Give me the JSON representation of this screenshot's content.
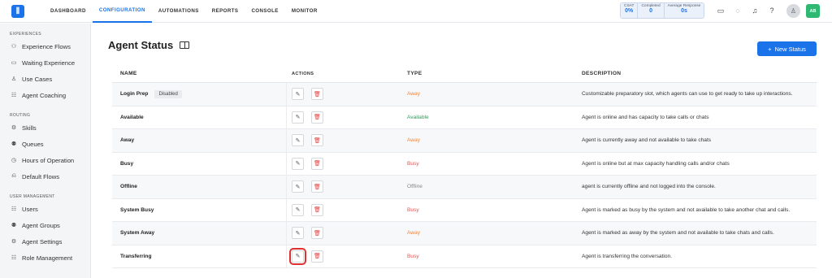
{
  "topnav": {
    "items": [
      {
        "label": "DASHBOARD",
        "active": false
      },
      {
        "label": "CONFIGURATION",
        "active": true
      },
      {
        "label": "AUTOMATIONS",
        "active": false
      },
      {
        "label": "REPORTS",
        "active": false
      },
      {
        "label": "CONSOLE",
        "active": false
      },
      {
        "label": "MONITOR",
        "active": false
      }
    ]
  },
  "metrics": [
    {
      "label": "CSAT",
      "value": "0%"
    },
    {
      "label": "Completed",
      "value": "0"
    },
    {
      "label": "Average Response",
      "value": "0s"
    }
  ],
  "user": {
    "initials": "AB"
  },
  "sidebar": {
    "sections": [
      {
        "title": "EXPERIENCES",
        "items": [
          {
            "label": "Experience Flows",
            "icon": "flow-icon",
            "glyph": "⚇"
          },
          {
            "label": "Waiting Experience",
            "icon": "monitor-icon",
            "glyph": "▭"
          },
          {
            "label": "Use Cases",
            "icon": "users-icon",
            "glyph": "♙"
          },
          {
            "label": "Agent Coaching",
            "icon": "coaching-icon",
            "glyph": "☷"
          }
        ]
      },
      {
        "title": "ROUTING",
        "items": [
          {
            "label": "Skills",
            "icon": "skills-icon",
            "glyph": "⚙"
          },
          {
            "label": "Queues",
            "icon": "queues-icon",
            "glyph": "⚉"
          },
          {
            "label": "Hours of Operation",
            "icon": "clock-icon",
            "glyph": "◷"
          },
          {
            "label": "Default Flows",
            "icon": "default-flow-icon",
            "glyph": "⎌"
          }
        ]
      },
      {
        "title": "USER MANAGEMENT",
        "items": [
          {
            "label": "Users",
            "icon": "user-icon",
            "glyph": "☷"
          },
          {
            "label": "Agent Groups",
            "icon": "groups-icon",
            "glyph": "⚉"
          },
          {
            "label": "Agent Settings",
            "icon": "settings-icon",
            "glyph": "⚙"
          },
          {
            "label": "Role Management",
            "icon": "role-icon",
            "glyph": "☷"
          }
        ]
      }
    ]
  },
  "page": {
    "title": "Agent Status",
    "new_button": "New Status"
  },
  "table": {
    "headers": {
      "name": "NAME",
      "actions": "ACTIONS",
      "type": "TYPE",
      "description": "DESCRIPTION"
    },
    "rows": [
      {
        "name": "Login Prep",
        "badge": "Disabled",
        "type": "Away",
        "type_class": "away",
        "description": "Customizable preparatory slot, which agents can use to get ready to take up interactions."
      },
      {
        "name": "Available",
        "badge": "",
        "type": "Available",
        "type_class": "avail",
        "description": "Agent is online and has capacity to take calls or chats"
      },
      {
        "name": "Away",
        "badge": "",
        "type": "Away",
        "type_class": "away",
        "description": "Agent is currently away and not available to take chats"
      },
      {
        "name": "Busy",
        "badge": "",
        "type": "Busy",
        "type_class": "busy",
        "description": "Agent is online but at max capacity handling calls and/or chats"
      },
      {
        "name": "Offline",
        "badge": "",
        "type": "Offline",
        "type_class": "off",
        "description": "agent is currently offline and not logged into the console."
      },
      {
        "name": "System Busy",
        "badge": "",
        "type": "Busy",
        "type_class": "busy",
        "description": "Agent is marked as busy by the system and not available to take another chat and calls."
      },
      {
        "name": "System Away",
        "badge": "",
        "type": "Away",
        "type_class": "away",
        "description": "Agent is marked as away by the system and not available to take chats and calls."
      },
      {
        "name": "Transferring",
        "badge": "",
        "type": "Busy",
        "type_class": "busy",
        "description": "Agent is transferring the conversation.",
        "highlight_edit": true
      }
    ]
  }
}
